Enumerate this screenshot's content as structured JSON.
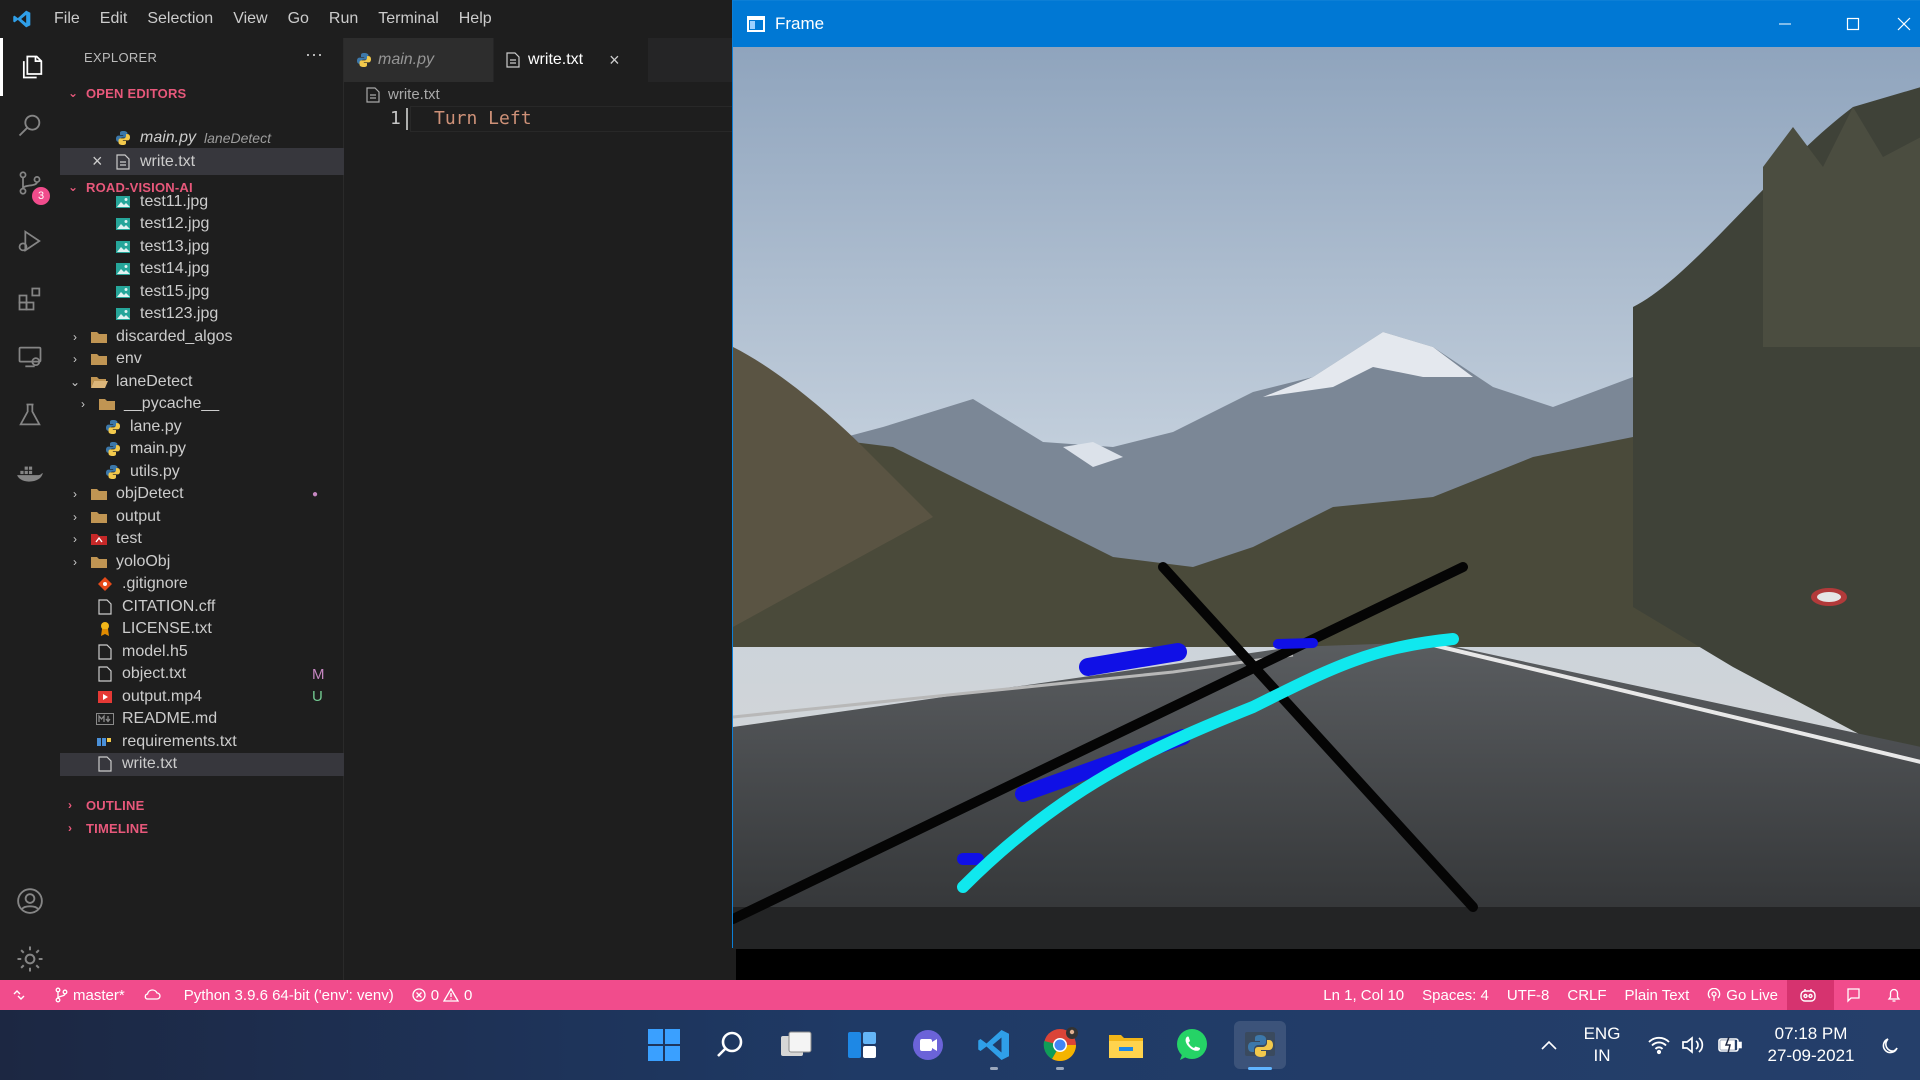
{
  "vscode": {
    "menu": [
      "File",
      "Edit",
      "Selection",
      "View",
      "Go",
      "Run",
      "Terminal",
      "Help"
    ],
    "activity_bar": {
      "items": [
        "explorer-icon",
        "search-icon",
        "source-control-icon",
        "run-debug-icon",
        "extensions-icon",
        "remote-explorer-icon",
        "testing-icon",
        "docker-icon"
      ],
      "scm_badge": "3",
      "bottom": [
        "account-icon",
        "manage-gear-icon"
      ]
    },
    "sidebar": {
      "title": "EXPLORER",
      "more": "···",
      "open_editors": {
        "header": "OPEN EDITORS",
        "items": [
          {
            "name": "main.py",
            "desc": "laneDetect"
          },
          {
            "name": "write.txt",
            "close": "×"
          }
        ]
      },
      "project": {
        "header": "ROAD-VISION-AI",
        "items": [
          {
            "name": "test11.jpg"
          },
          {
            "name": "test12.jpg"
          },
          {
            "name": "test13.jpg"
          },
          {
            "name": "test14.jpg"
          },
          {
            "name": "test15.jpg"
          },
          {
            "name": "test123.jpg"
          },
          {
            "name": "discarded_algos"
          },
          {
            "name": "env"
          },
          {
            "name": "laneDetect"
          },
          {
            "name": "__pycache__"
          },
          {
            "name": "lane.py"
          },
          {
            "name": "main.py"
          },
          {
            "name": "utils.py"
          },
          {
            "name": "objDetect",
            "badge": "●"
          },
          {
            "name": "output"
          },
          {
            "name": "test"
          },
          {
            "name": "yoloObj"
          },
          {
            "name": ".gitignore"
          },
          {
            "name": "CITATION.cff"
          },
          {
            "name": "LICENSE.txt"
          },
          {
            "name": "model.h5"
          },
          {
            "name": "object.txt",
            "badge": "M"
          },
          {
            "name": "output.mp4",
            "badge": "U"
          },
          {
            "name": "README.md"
          },
          {
            "name": "requirements.txt"
          },
          {
            "name": "write.txt"
          }
        ]
      },
      "outline_header": "OUTLINE",
      "timeline_header": "TIMELINE"
    },
    "tabs": [
      {
        "label": "main.py"
      },
      {
        "label": "write.txt",
        "close": "×"
      }
    ],
    "breadcrumb": "write.txt",
    "editor": {
      "line_number": "1",
      "code": "Turn Left"
    },
    "statusbar": {
      "branch": "master*",
      "python": "Python 3.9.6 64-bit ('env': venv)",
      "errors": "0",
      "warnings": "0",
      "position": "Ln 1, Col 10",
      "spaces": "Spaces: 4",
      "encoding": "UTF-8",
      "eol": "CRLF",
      "language": "Plain Text",
      "golive": "Go Live",
      "background": "#f14c8c"
    }
  },
  "frame_window": {
    "title": "Frame",
    "titlebar_color": "#0078d4"
  },
  "taskbar": {
    "apps": [
      "windows-start-icon",
      "search-icon",
      "task-view-icon",
      "widgets-icon",
      "teams-chat-icon",
      "vscode-icon",
      "chrome-icon",
      "file-explorer-icon",
      "whatsapp-icon",
      "python-icon"
    ],
    "tray": {
      "lang_top": "ENG",
      "lang_bottom": "IN",
      "time": "07:18 PM",
      "date": "27-09-2021"
    }
  }
}
